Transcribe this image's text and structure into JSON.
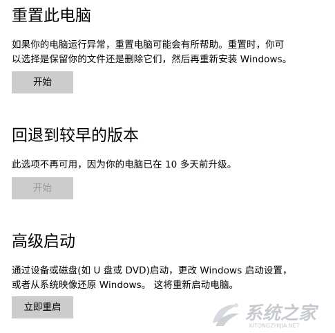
{
  "reset": {
    "title": "重置此电脑",
    "description_line1": "如果你的电脑运行异常，重置电脑可能会有所帮助。重置时，你可",
    "description_line2": "以选择是保留你的文件还是删除它们，然后再重新安装 Windows。",
    "button_label": "开始"
  },
  "rollback": {
    "title": "回退到较早的版本",
    "description_line1": "此选项不再可用，因为你的电脑已在 10 多天前升级。",
    "button_label": "开始",
    "button_enabled": false
  },
  "advanced_startup": {
    "title": "高级启动",
    "description_line1": "通过设备或磁盘(如 U 盘或 DVD)启动，更改 Windows 启动设置，",
    "description_line2": "或者从系统映像还原 Windows。 这将重新启动电脑。",
    "button_label": "立即重启"
  },
  "watermark": {
    "text": "系统之家",
    "url": "XITONGZHIJIA.NET",
    "icon": "xitongzhijia-logo-icon"
  },
  "colors": {
    "background": "#ffffff",
    "button_bg": "#cccccc",
    "text": "#000000",
    "disabled_text": "#9a9a9a"
  }
}
